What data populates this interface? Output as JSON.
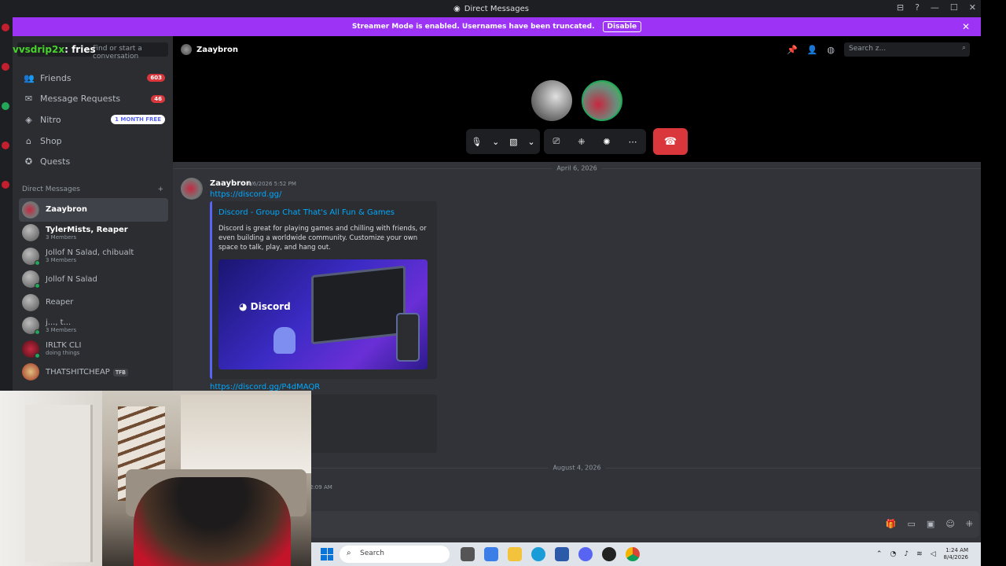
{
  "window": {
    "title": "Direct Messages",
    "controls": [
      "⊟",
      "?",
      "—",
      "☐",
      "✕"
    ]
  },
  "banner": {
    "message": "Streamer Mode is enabled. Usernames have been truncated.",
    "disable_label": "Disable"
  },
  "sidebar": {
    "find_placeholder": "Find or start a conversation",
    "overlay_name_prefix": "vvsdrip2x",
    "overlay_name_suffix": ": fries",
    "nav": [
      {
        "label": "Friends",
        "icon": "friends-icon",
        "badge": "603"
      },
      {
        "label": "Message Requests",
        "icon": "mail-icon",
        "badge": "46"
      },
      {
        "label": "Nitro",
        "icon": "nitro-icon",
        "pill": "1 MONTH FREE"
      },
      {
        "label": "Shop",
        "icon": "shop-icon"
      },
      {
        "label": "Quests",
        "icon": "quests-icon"
      }
    ],
    "dm_header": "Direct Messages",
    "dm_add": "+",
    "dms": [
      {
        "name": "Zaaybron",
        "sub": ""
      },
      {
        "name": "TylerMists, Reaper",
        "sub": "3 Members"
      },
      {
        "name": "Jollof N Salad, chibualt",
        "sub": "3 Members"
      },
      {
        "name": "Jollof N Salad",
        "sub": ""
      },
      {
        "name": "Reaper",
        "sub": ""
      },
      {
        "name": "j..., t...",
        "sub": "3 Members"
      },
      {
        "name": "IRLTK CLI",
        "sub": "doing things"
      },
      {
        "name": "THATSHITCHEAP",
        "sub": "",
        "tag": "TFB"
      }
    ]
  },
  "call": {
    "channel_name": "Zaaybron",
    "search_placeholder": "Search z...",
    "end_call_icon": "phone-hangup-icon"
  },
  "chat": {
    "date1": "April 6, 2026",
    "author": "Zaaybron",
    "timestamp": "4/6/2026 5:52 PM",
    "link1": "https://discord.gg/",
    "embed_title": "Discord - Group Chat That's All Fun & Games",
    "embed_desc": "Discord is great for playing games and chilling with friends, or even building a worldwide community. Customize your own space to talk, play, and hang out.",
    "embed_logo": "Discord",
    "link2": "https://discord.gg/P4dMAQR",
    "date2": "August 4, 2026",
    "time2": "2:09 AM"
  },
  "taskbar": {
    "search_label": "Search",
    "clock_time": "1:24 AM",
    "clock_date": "8/4/2026"
  },
  "colors": {
    "banner": "#9c33f5",
    "end_call": "#da373c",
    "link": "#00a8fc",
    "online": "#23a55a"
  }
}
